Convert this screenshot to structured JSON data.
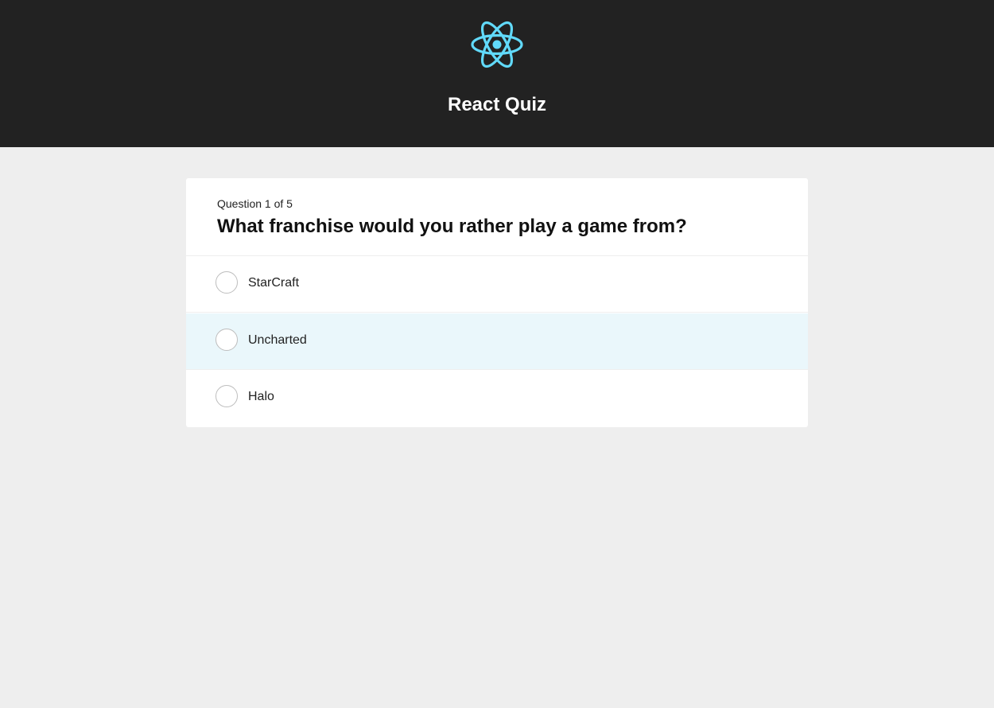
{
  "header": {
    "logo_icon": "react-atom-icon",
    "logo_color": "#61dafb",
    "title": "React Quiz"
  },
  "quiz": {
    "question_counter": "Question 1 of 5",
    "question_number": 1,
    "question_total": 5,
    "question": "What franchise would you rather play a game from?",
    "answers": [
      {
        "label": "StarCraft",
        "state": "default"
      },
      {
        "label": "Uncharted",
        "state": "hover"
      },
      {
        "label": "Halo",
        "state": "default"
      }
    ]
  },
  "colors": {
    "header_background": "#222222",
    "page_background": "#eeeeee",
    "card_background": "#ffffff",
    "hover_background": "#eaf7fb",
    "title_text": "#ffffff"
  }
}
